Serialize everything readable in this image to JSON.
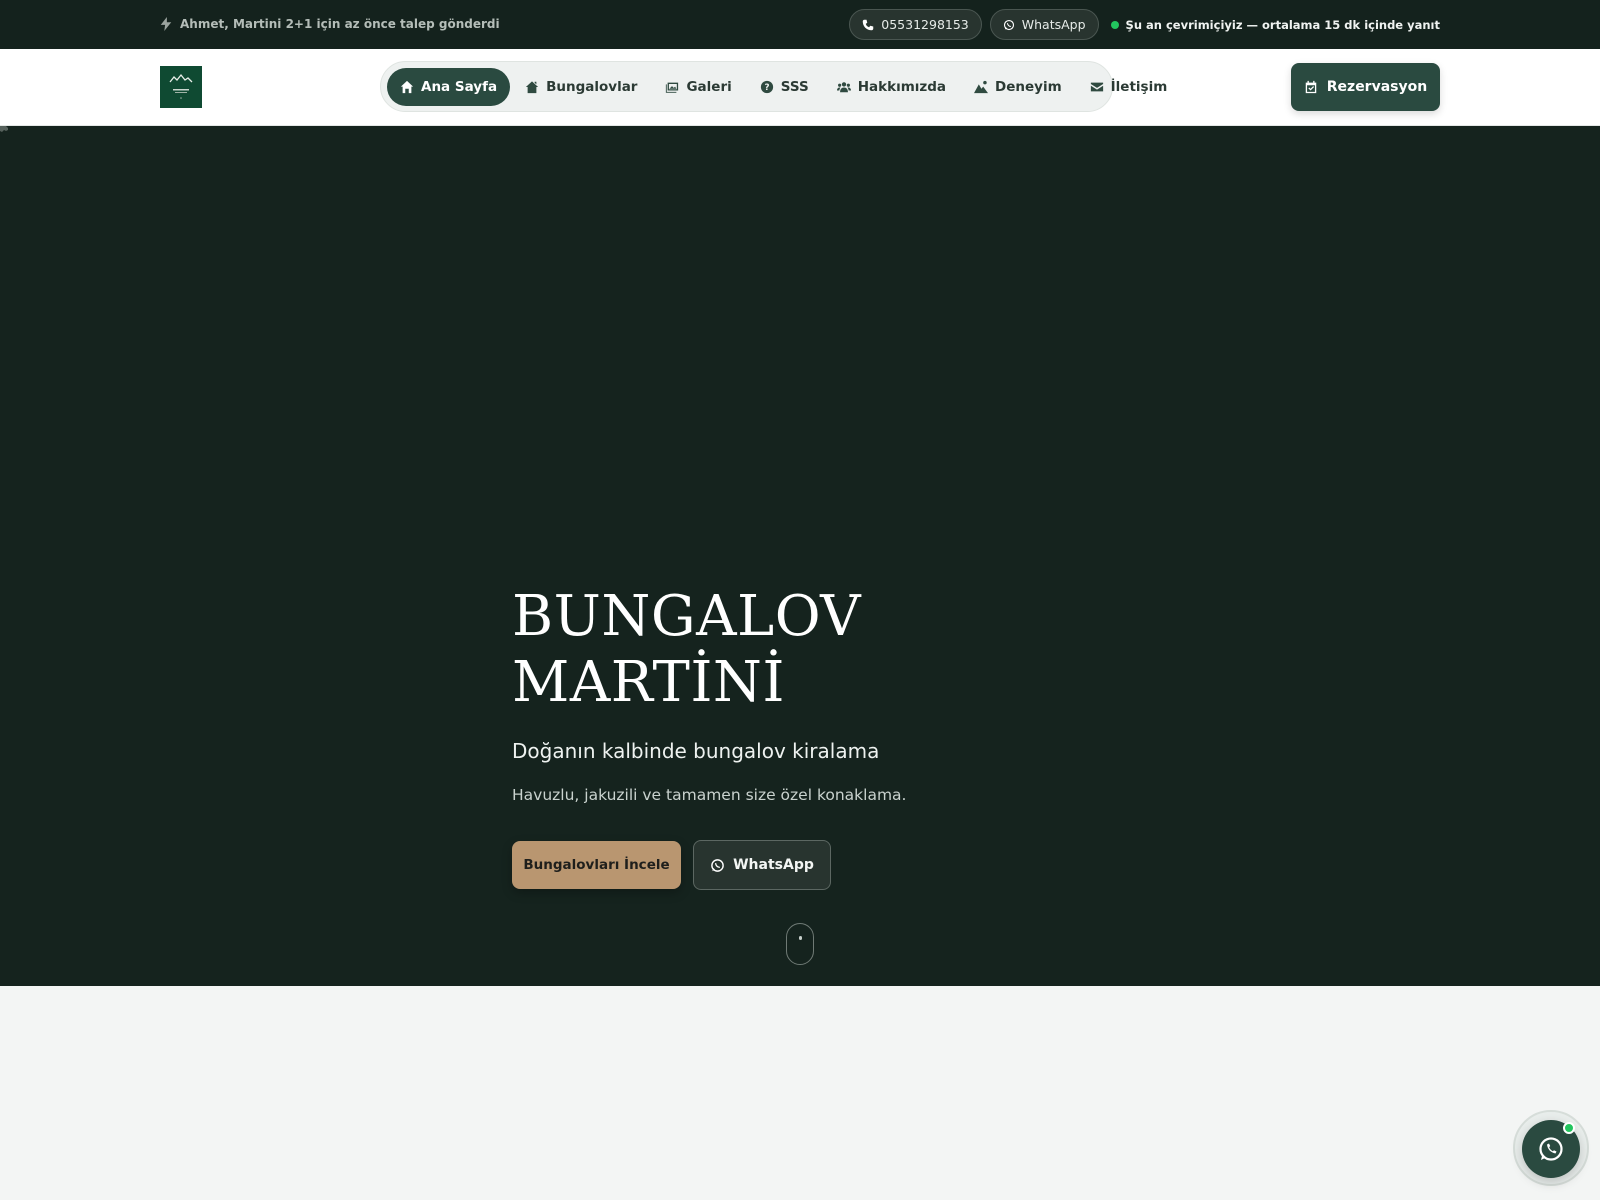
{
  "topbar": {
    "activity_text": "Ahmet, Martini 2+1 için az önce talep gönderdi",
    "phone": "05531298153",
    "whatsapp_label": "WhatsApp",
    "online_text": "Şu an çevrimiçiyiz — ortalama 15 dk içinde yanıt"
  },
  "nav": {
    "items": [
      {
        "label": "Ana Sayfa",
        "icon": "home-icon"
      },
      {
        "label": "Bungalovlar",
        "icon": "house-icon"
      },
      {
        "label": "Galeri",
        "icon": "images-icon"
      },
      {
        "label": "SSS",
        "icon": "question-circle-icon"
      },
      {
        "label": "Hakkımızda",
        "icon": "users-icon"
      },
      {
        "label": "Deneyim",
        "icon": "mountain-person-icon"
      },
      {
        "label": "İletişim",
        "icon": "envelope-icon"
      }
    ],
    "reserve_label": "Rezervasyon"
  },
  "hero": {
    "title_line1": "BUNGALOV",
    "title_line2": "MARTİNİ",
    "subtitle": "Doğanın kalbinde bungalov kiralama",
    "description": "Havuzlu, jakuzili ve tamamen size özel konaklama.",
    "primary_button": "Bungalovları İncele",
    "whatsapp_button": "WhatsApp"
  },
  "colors": {
    "dark_green": "#14221d",
    "brand_green": "#2a4a40",
    "accent_tan": "#b99670",
    "online_green": "#22c55e",
    "page_bg": "#f3f5f4"
  }
}
